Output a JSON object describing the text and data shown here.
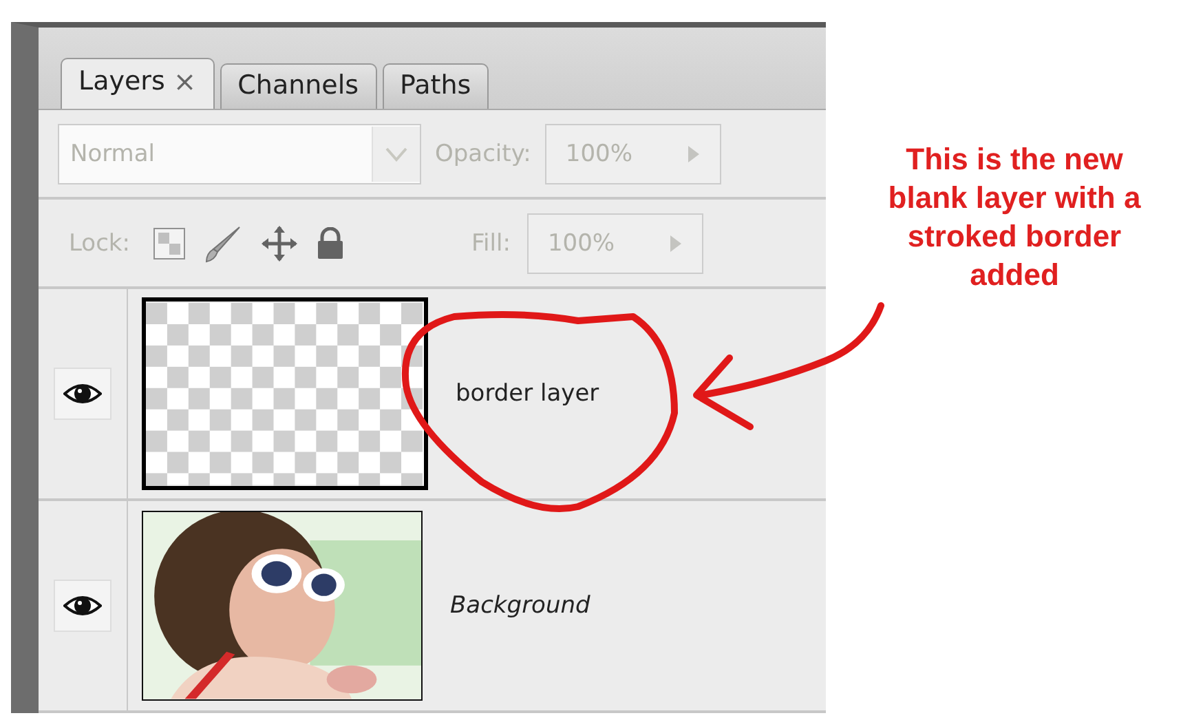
{
  "panel": {
    "tabs": [
      {
        "label": "Layers",
        "close": "×",
        "selected": true
      },
      {
        "label": "Channels",
        "selected": false
      },
      {
        "label": "Paths",
        "selected": false
      }
    ],
    "options": {
      "disabled": true,
      "blend_mode": "Normal",
      "opacity_label": "Opacity:",
      "opacity": "100%",
      "lock_label": "Lock:",
      "fill_label": "Fill:",
      "fill": "100%"
    },
    "layers": [
      {
        "name": "border layer",
        "visible": true,
        "kind": "transparent",
        "is_background": false
      },
      {
        "name": "Background",
        "visible": true,
        "kind": "picture",
        "is_background": true
      }
    ]
  },
  "annotation": {
    "text": "This is the new blank layer with a stroked border added"
  }
}
